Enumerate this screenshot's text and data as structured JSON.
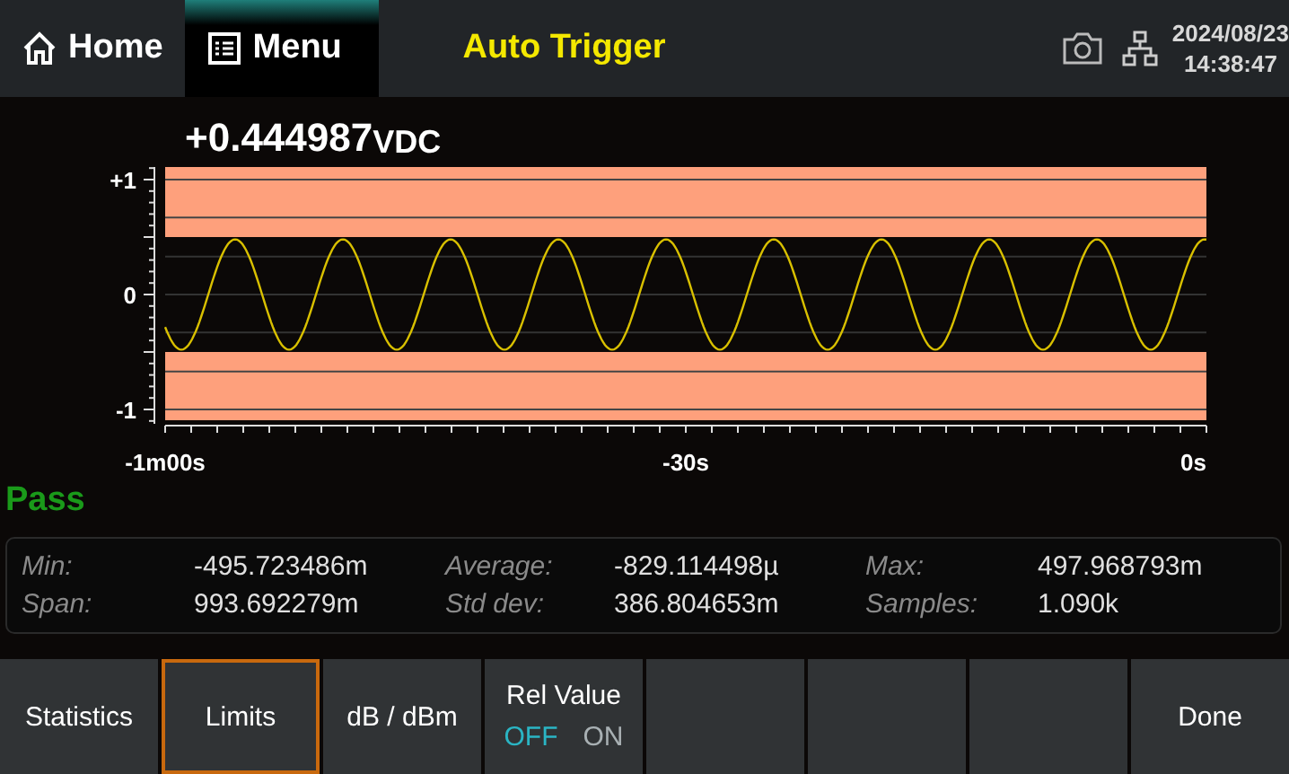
{
  "top_bar": {
    "home": "Home",
    "menu": "Menu",
    "title": "Auto Trigger",
    "date": "2024/08/23",
    "time": "14:38:47"
  },
  "reading": {
    "value": "+0.444987",
    "unit": "VDC"
  },
  "chart": {
    "y_ticks": [
      "+1",
      "0",
      "-1"
    ],
    "x_ticks": [
      "-1m00s",
      "-30s",
      "0s"
    ]
  },
  "result": "Pass",
  "stats": [
    {
      "label": "Min:",
      "value": "-495.723486m"
    },
    {
      "label": "Average:",
      "value": "-829.114498µ"
    },
    {
      "label": "Max:",
      "value": "497.968793m"
    },
    {
      "label": "Span:",
      "value": "993.692279m"
    },
    {
      "label": "Std dev:",
      "value": "386.804653m"
    },
    {
      "label": "Samples:",
      "value": "1.090k"
    }
  ],
  "softkeys": [
    {
      "kind": "button",
      "label": "Statistics",
      "selected": false
    },
    {
      "kind": "button",
      "label": "Limits",
      "selected": true
    },
    {
      "kind": "button",
      "label": "dB / dBm",
      "selected": false
    },
    {
      "kind": "toggle",
      "label": "Rel Value",
      "options": [
        {
          "label": "OFF",
          "selected": true
        },
        {
          "label": "ON",
          "selected": false
        }
      ]
    },
    {
      "kind": "empty"
    },
    {
      "kind": "empty"
    },
    {
      "kind": "empty"
    },
    {
      "kind": "button",
      "label": "Done",
      "selected": false
    }
  ]
}
